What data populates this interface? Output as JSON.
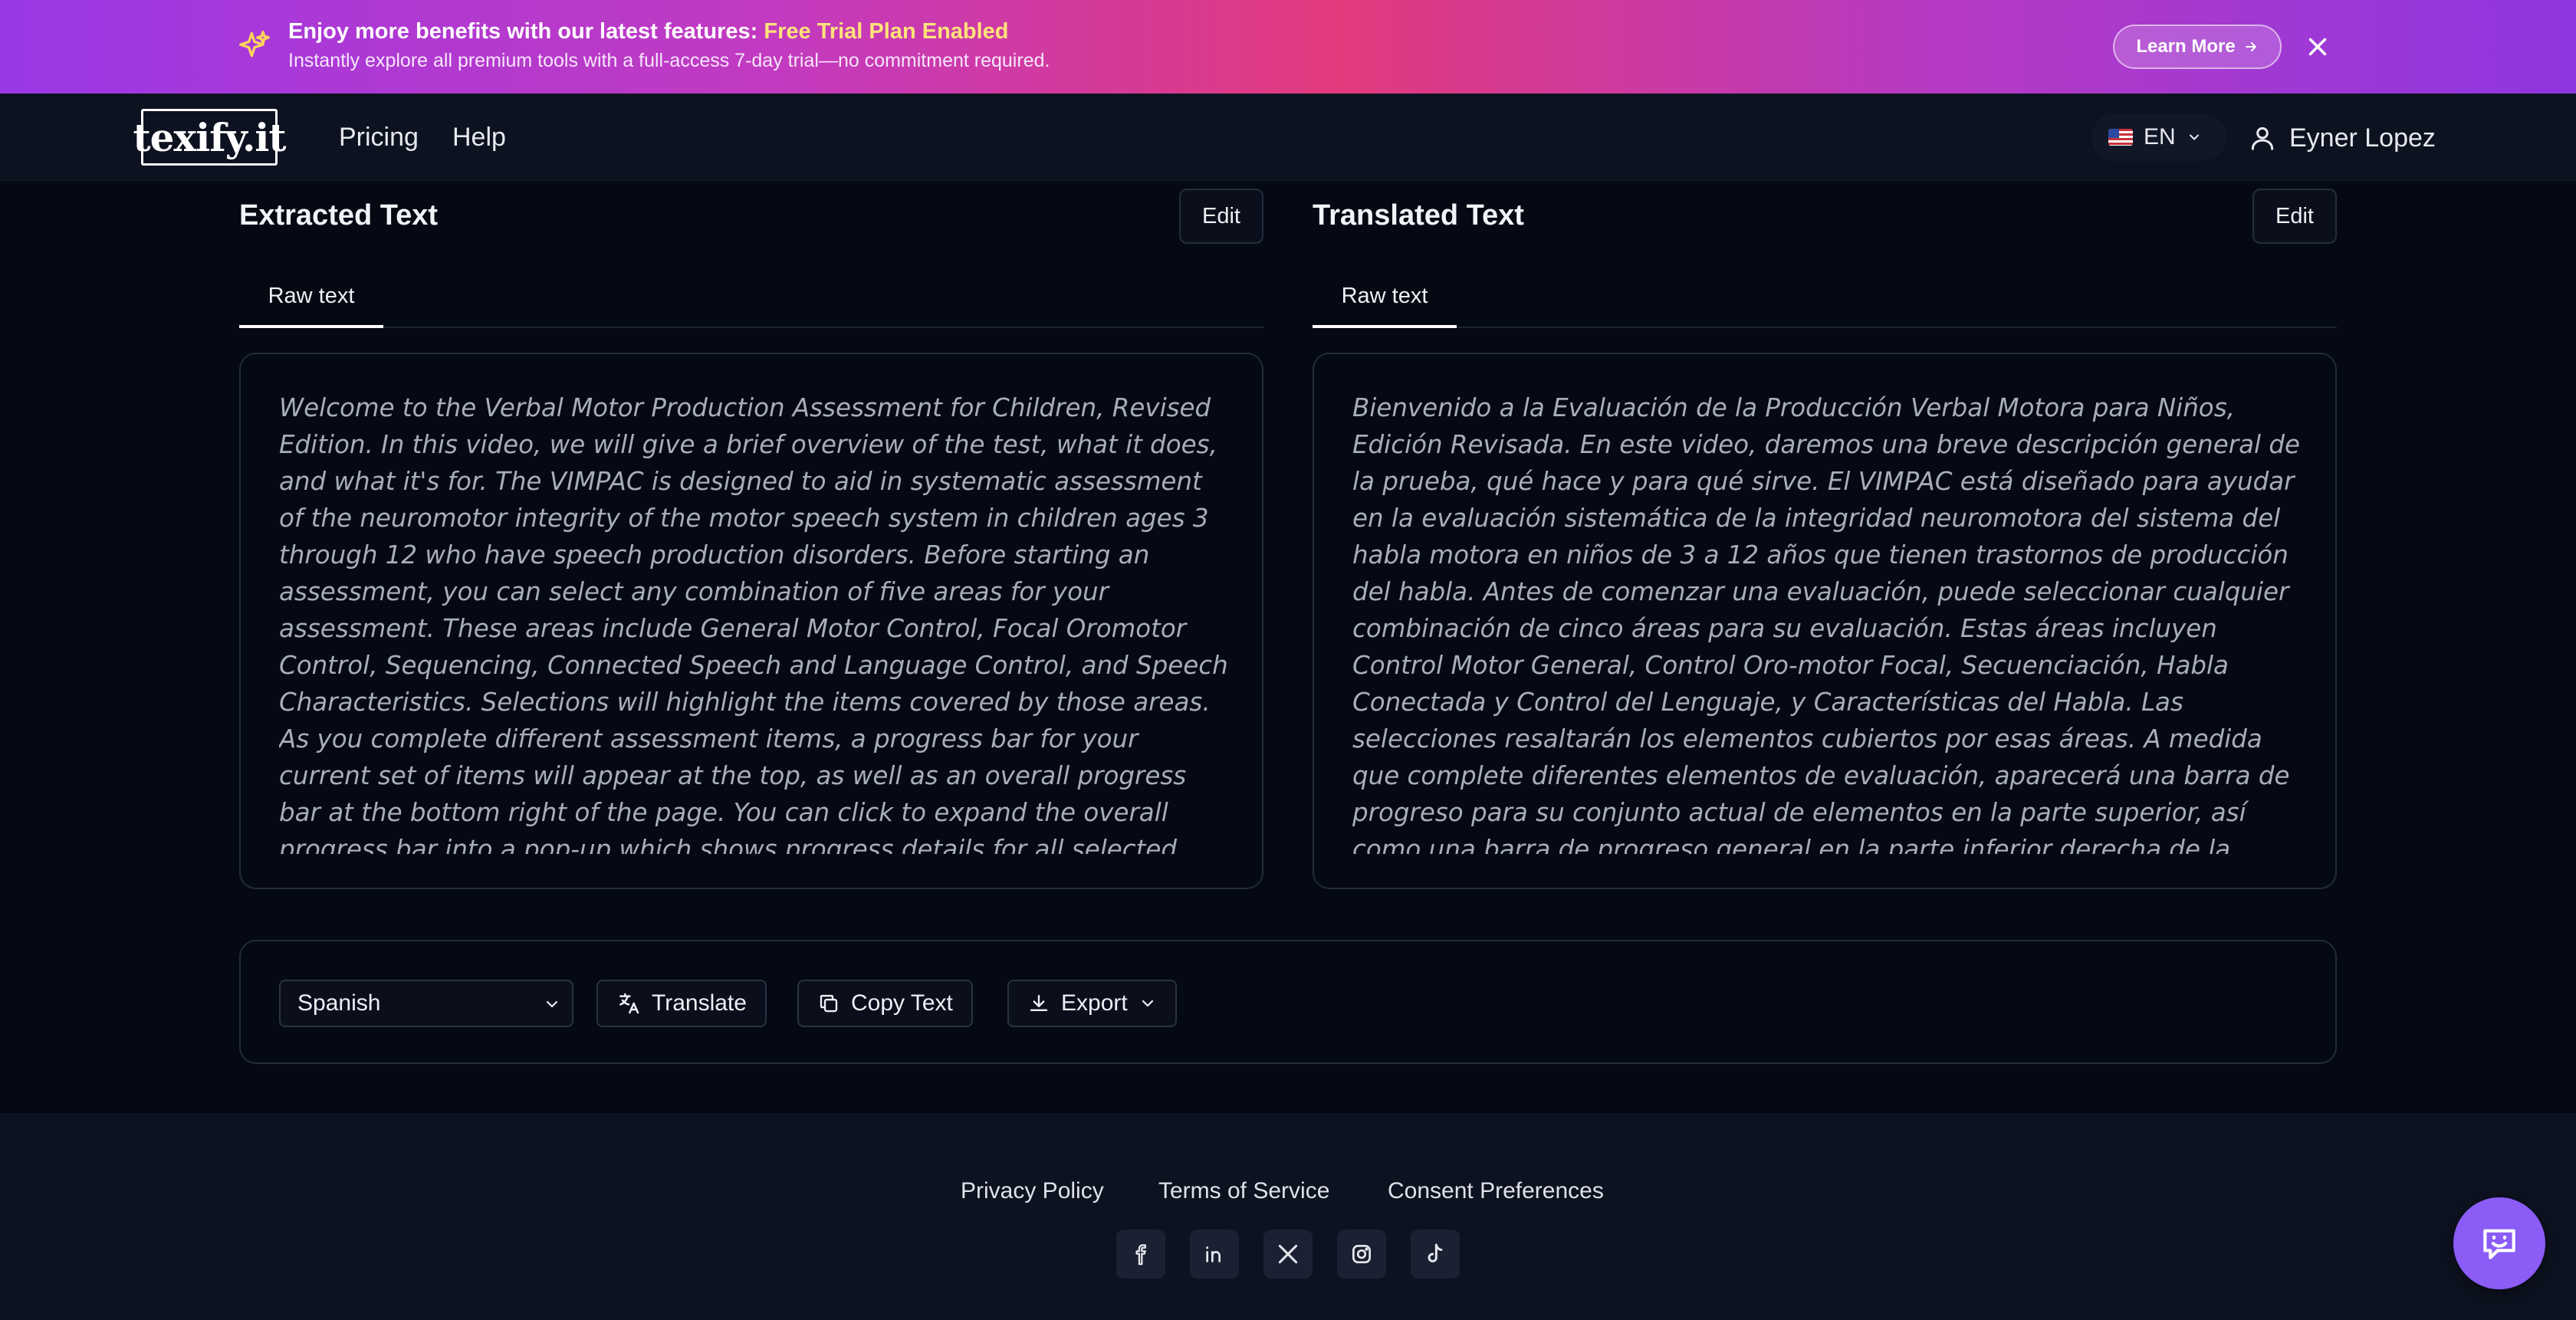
{
  "banner": {
    "title_prefix": "Enjoy more benefits with our latest features: ",
    "title_highlight": "Free Trial Plan Enabled",
    "subtitle": "Instantly explore all premium tools with a full-access 7-day trial—no commitment required.",
    "learn_more": "Learn More",
    "icons": [
      "sparkles-icon",
      "arrow-right-icon",
      "close-icon"
    ]
  },
  "nav": {
    "logo": "texify.it",
    "links": [
      "Pricing",
      "Help"
    ],
    "language": "EN",
    "user_name": "Eyner Lopez",
    "icons": [
      "us-flag-icon",
      "chevron-down-icon",
      "user-icon"
    ]
  },
  "extracted": {
    "title": "Extracted Text",
    "edit_label": "Edit",
    "tab": "Raw text",
    "text": "Welcome to the Verbal Motor Production Assessment for Children, Revised Edition. In this video, we will give a brief overview of the test, what it does, and what it's for. The VIMPAC is designed to aid in systematic assessment of the neuromotor integrity of the motor speech system in children ages 3 through 12 who have speech production disorders. Before starting an assessment, you can select any combination of five areas for your assessment. These areas include General Motor Control, Focal Oromotor Control, Sequencing, Connected Speech and Language Control, and Speech Characteristics. Selections will highlight the items covered by those areas. As you complete different assessment items, a progress bar for your current set of items will appear at the top, as well as an overall progress bar at the bottom right of the page. You can click to expand the overall progress bar into a pop-up which shows progress details for all selected areas. In the"
  },
  "translated": {
    "title": "Translated Text",
    "edit_label": "Edit",
    "tab": "Raw text",
    "text": "Bienvenido a la Evaluación de la Producción Verbal Motora para Niños, Edición Revisada. En este video, daremos una breve descripción general de la prueba, qué hace y para qué sirve. El VIMPAC está diseñado para ayudar en la evaluación sistemática de la integridad neuromotora del sistema del habla motora en niños de 3 a 12 años que tienen trastornos de producción del habla. Antes de comenzar una evaluación, puede seleccionar cualquier combinación de cinco áreas para su evaluación. Estas áreas incluyen Control Motor General, Control Oro-motor Focal, Secuenciación, Habla Conectada y Control del Lenguaje, y Características del Habla. Las selecciones resaltarán los elementos cubiertos por esas áreas. A medida que complete diferentes elementos de evaluación, aparecerá una barra de progreso para su conjunto actual de elementos en la parte superior, así como una barra de progreso general en la parte inferior derecha de la página. Puede hacer clic para"
  },
  "toolbar": {
    "language_selected": "Spanish",
    "translate": "Translate",
    "copy": "Copy Text",
    "export": "Export",
    "icons": [
      "translate-icon",
      "copy-icon",
      "download-icon",
      "chevron-down-icon"
    ]
  },
  "footer": {
    "links": [
      "Privacy Policy",
      "Terms of Service",
      "Consent Preferences"
    ],
    "social_icons": [
      "facebook-icon",
      "linkedin-icon",
      "x-icon",
      "instagram-icon",
      "tiktok-icon"
    ]
  },
  "chat": {
    "icon": "chat-support-icon"
  },
  "colors": {
    "banner_gradient_start": "#9a38e6",
    "banner_gradient_mid": "#e23a7d",
    "banner_highlight": "#ffe27a",
    "page_background": "#050913",
    "nav_background": "#0d1220",
    "chat_fab": "#8b5cf6"
  }
}
